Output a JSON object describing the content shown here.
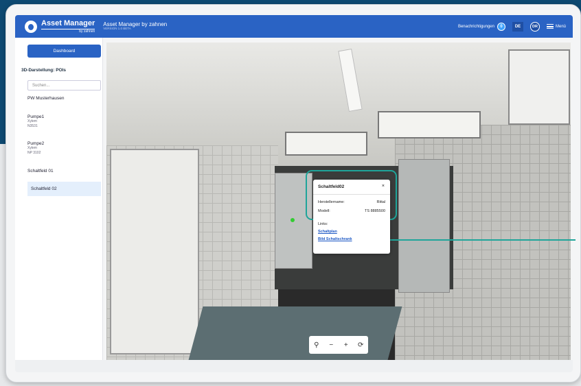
{
  "header": {
    "logo_title": "Asset Manager",
    "logo_sub": "by zahnen",
    "app_title": "Asset Manager by zahnen",
    "app_subtitle": "VERSION 1.0 BETA",
    "notifications_label": "Benachrichtigungen",
    "notifications_count": "0",
    "language": "DE",
    "user_initials": "DR",
    "menu_label": "Menü"
  },
  "sidebar": {
    "dashboard_label": "Dashboard",
    "heading": "3D-Darstellung: POIs",
    "search_placeholder": "Suchen...",
    "items": [
      {
        "title": "PW Musterhausen",
        "line1": "",
        "line2": ""
      },
      {
        "title": "Pumpe1",
        "line1": "Xylem",
        "line2": "N3531"
      },
      {
        "title": "Pumpe2",
        "line1": "Xylem",
        "line2": "NP 3102"
      },
      {
        "title": "Schaltfeld 01",
        "line1": "",
        "line2": ""
      },
      {
        "title": "Schaltfeld 02",
        "line1": "",
        "line2": ""
      }
    ],
    "active_index": 4
  },
  "popup": {
    "title": "Schaltfeld02",
    "close_symbol": "×",
    "rows": [
      {
        "label": "Herstellername:",
        "value": "Rittal"
      },
      {
        "label": "Modell:",
        "value": "TS 8885500"
      }
    ],
    "links_label": "Links:",
    "links": [
      "Schaltplan",
      "Bild Schaltschrank"
    ]
  },
  "controls": {
    "pin": "⚲",
    "zoom_out": "−",
    "zoom_in": "+",
    "rotate": "⟳"
  },
  "colors": {
    "primary": "#2a63c4",
    "accent": "#1fa59a",
    "active_item": "#e4effc"
  }
}
